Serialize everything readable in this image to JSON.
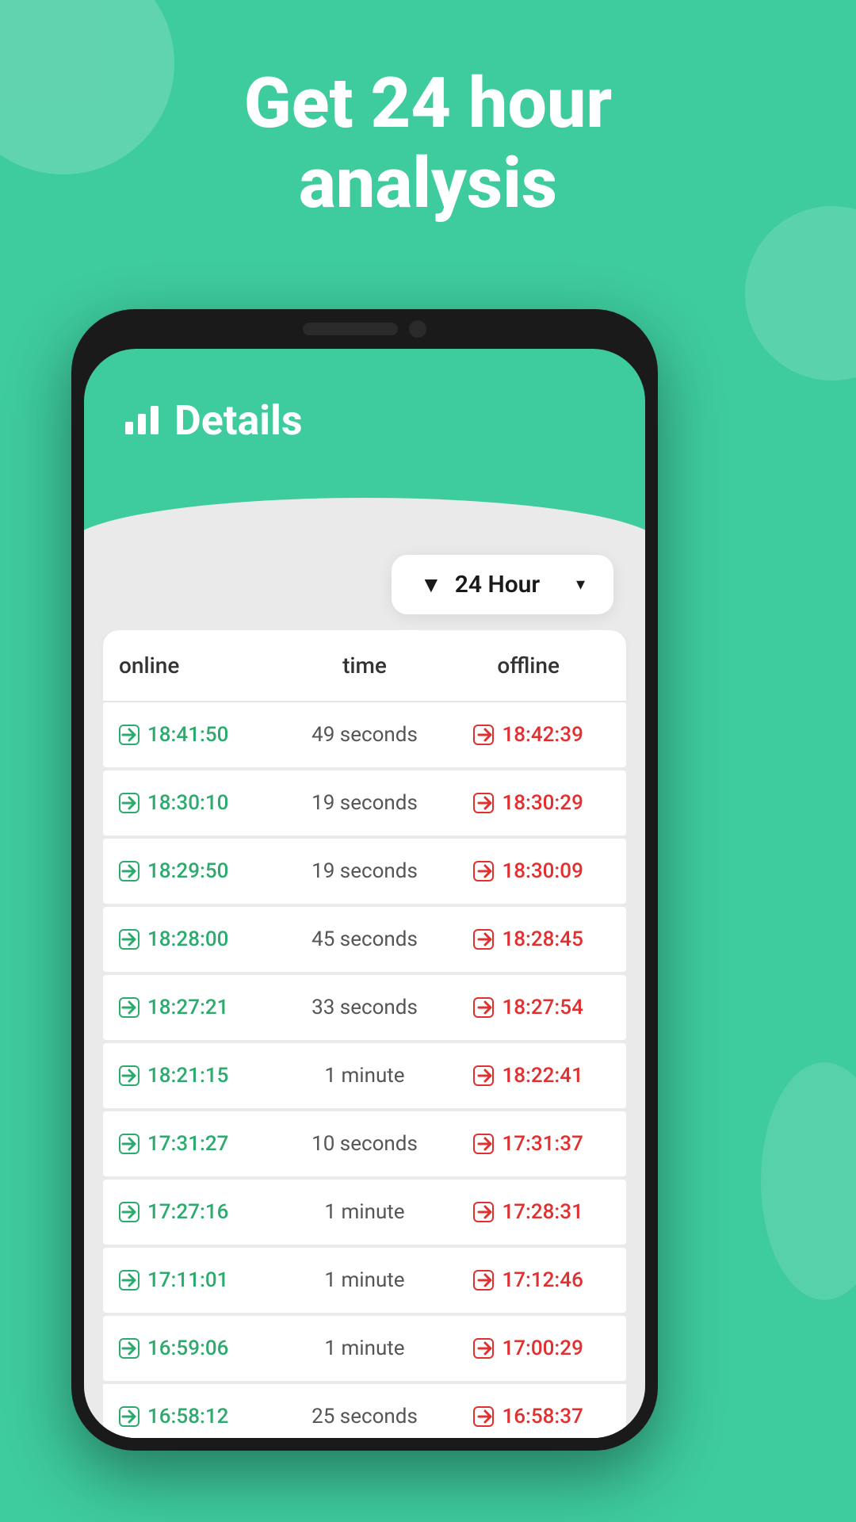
{
  "hero": {
    "line1": "Get 24 hour",
    "line2": "analysis"
  },
  "app": {
    "header_title": "Details",
    "filter_label": "24 Hour"
  },
  "table": {
    "headers": {
      "online": "online",
      "time": "time",
      "offline": "offline"
    },
    "rows": [
      {
        "online": "18:41:50",
        "time": "49 seconds",
        "offline": "18:42:39"
      },
      {
        "online": "18:30:10",
        "time": "19 seconds",
        "offline": "18:30:29"
      },
      {
        "online": "18:29:50",
        "time": "19 seconds",
        "offline": "18:30:09"
      },
      {
        "online": "18:28:00",
        "time": "45 seconds",
        "offline": "18:28:45"
      },
      {
        "online": "18:27:21",
        "time": "33 seconds",
        "offline": "18:27:54"
      },
      {
        "online": "18:21:15",
        "time": "1 minute",
        "offline": "18:22:41"
      },
      {
        "online": "17:31:27",
        "time": "10 seconds",
        "offline": "17:31:37"
      },
      {
        "online": "17:27:16",
        "time": "1 minute",
        "offline": "17:28:31"
      },
      {
        "online": "17:11:01",
        "time": "1 minute",
        "offline": "17:12:46"
      },
      {
        "online": "16:59:06",
        "time": "1 minute",
        "offline": "17:00:29"
      },
      {
        "online": "16:58:12",
        "time": "25 seconds",
        "offline": "16:58:37"
      }
    ]
  },
  "icons": {
    "filter": "▼",
    "login_arrow": "→",
    "logout_arrow": "⇥",
    "bar_chart": "📊"
  },
  "colors": {
    "brand_green": "#3ecb9e",
    "online_green": "#2daa6e",
    "offline_red": "#e03030"
  }
}
